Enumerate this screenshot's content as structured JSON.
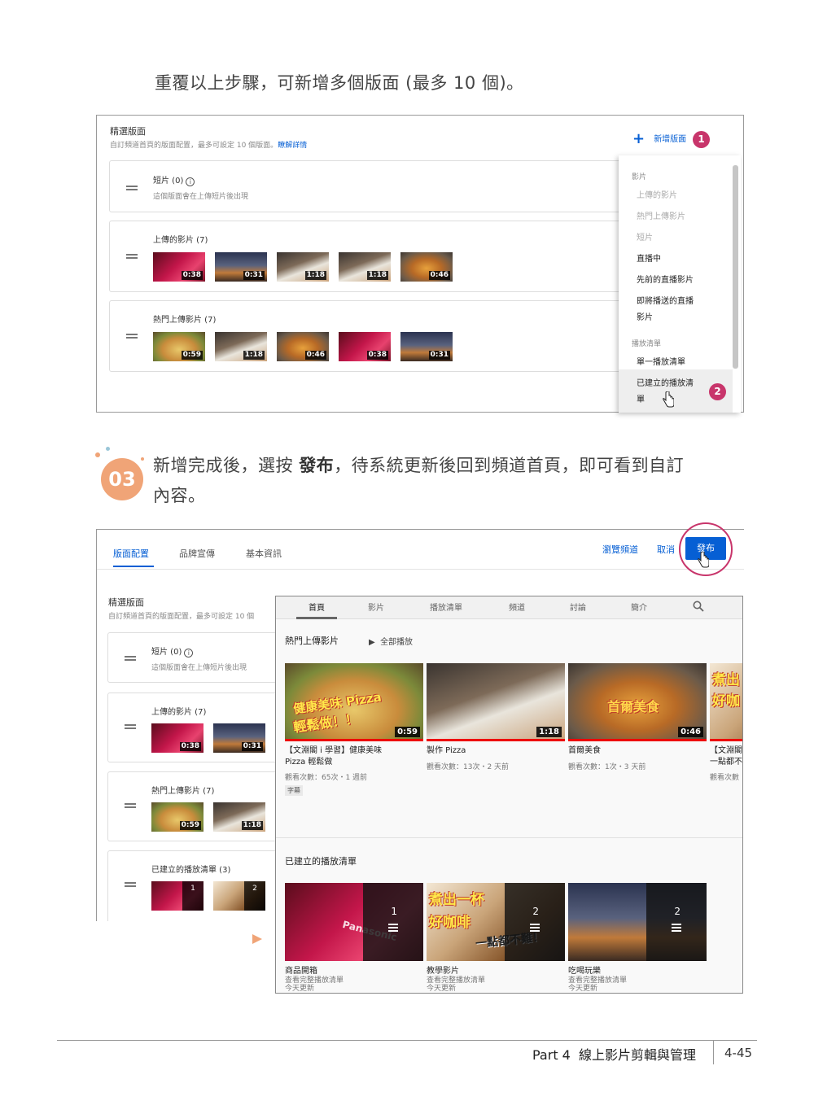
{
  "intro_text": "重覆以上步驟，可新增多個版面 (最多 10 個)。",
  "shot1": {
    "section_title": "精選版面",
    "section_subtitle": "自訂頻道首頁的版面配置，最多可設定 10 個版面。",
    "learn_more": "瞭解詳情",
    "add_section_label": "新增版面",
    "shorts_card": {
      "title": "短片 (0)",
      "subtitle": "這個版面會在上傳短片後出現"
    },
    "uploads_card": {
      "title": "上傳的影片 (7)",
      "durations": [
        "0:38",
        "0:31",
        "1:18",
        "1:18",
        "0:46"
      ]
    },
    "popular_card": {
      "title": "熱門上傳影片 (7)",
      "durations": [
        "0:59",
        "1:18",
        "0:46",
        "0:38",
        "0:31"
      ]
    },
    "dropdown": {
      "group_videos": "影片",
      "items_videos": [
        "上傳的影片",
        "熱門上傳影片",
        "短片",
        "直播中",
        "先前的直播影片",
        "即將播送的直播",
        "影片"
      ],
      "group_playlists": "播放清單",
      "items_playlists": [
        "單一播放清單",
        "已建立的播放清",
        "單"
      ]
    },
    "callouts": [
      "1",
      "2"
    ]
  },
  "step": {
    "number": "03",
    "line1_a": "新增完成後，選按",
    "line1_bold": "發布",
    "line1_b": "，待系統更新後回到頻道首頁，即可看到自訂",
    "line2": "內容。"
  },
  "shot2": {
    "tabs": [
      "版面配置",
      "品牌宣傳",
      "基本資訊"
    ],
    "view_channel": "瀏覽頻道",
    "cancel": "取消",
    "publish": "發布",
    "section_title": "精選版面",
    "section_subtitle": "自訂頻道首頁的版面配置，最多可設定 10 個",
    "shorts_card": {
      "title": "短片 (0)",
      "subtitle": "這個版面會在上傳短片後出現"
    },
    "uploads_card": {
      "title": "上傳的影片 (7)",
      "durations": [
        "0:38",
        "0:31"
      ]
    },
    "popular_card": {
      "title": "熱門上傳影片 (7)",
      "durations": [
        "0:59",
        "1:18"
      ]
    },
    "playlists_card": {
      "title": "已建立的播放清單 (3)",
      "counts": [
        "1",
        "2"
      ]
    }
  },
  "preview": {
    "tabs": [
      "首頁",
      "影片",
      "播放清單",
      "頻道",
      "討論",
      "簡介"
    ],
    "popular_heading": "熱門上傳影片",
    "play_all": "全部播放",
    "videos": [
      {
        "title1": "【文淵閣 i 學習】健康美味",
        "title2": "Pizza 輕鬆做",
        "meta": "觀看次數：65次・1 週前",
        "duration": "0:59",
        "overlay1": "健康美味 Pizza",
        "overlay2": "輕鬆做！！",
        "badge": "字幕"
      },
      {
        "title1": "製作 Pizza",
        "title2": "",
        "meta": "觀看次數：13次・2 天前",
        "duration": "1:18"
      },
      {
        "title1": "首爾美食",
        "title2": "",
        "meta": "觀看次數：1次・3 天前",
        "duration": "0:46",
        "overlay1": "首爾美食"
      },
      {
        "title1": "【文淵閣",
        "title2": "一點都不",
        "meta": "觀看次數",
        "overlay1": "煮出",
        "overlay2": "好咖"
      }
    ],
    "playlists_heading": "已建立的播放清單",
    "playlists": [
      {
        "title": "商品開箱",
        "updated": "今天更新",
        "link": "查看完整播放清單",
        "count": "1",
        "overlay1": "Panasonic"
      },
      {
        "title": "教學影片",
        "updated": "今天更新",
        "link": "查看完整播放清單",
        "count": "2",
        "overlay1": "煮出一杯",
        "overlay2": "好咖啡",
        "overlay3": "一點都不難！"
      },
      {
        "title": "吃喝玩樂",
        "updated": "今天更新",
        "link": "查看完整播放清單",
        "count": "2"
      }
    ]
  },
  "footer": {
    "part": "Part 4",
    "chapter": "線上影片剪輯與管理",
    "page_number": "4-45"
  },
  "colors": {
    "accent_blue": "#065fd4",
    "callout_pink": "#c8356b",
    "step_badge": "#f0a477"
  }
}
